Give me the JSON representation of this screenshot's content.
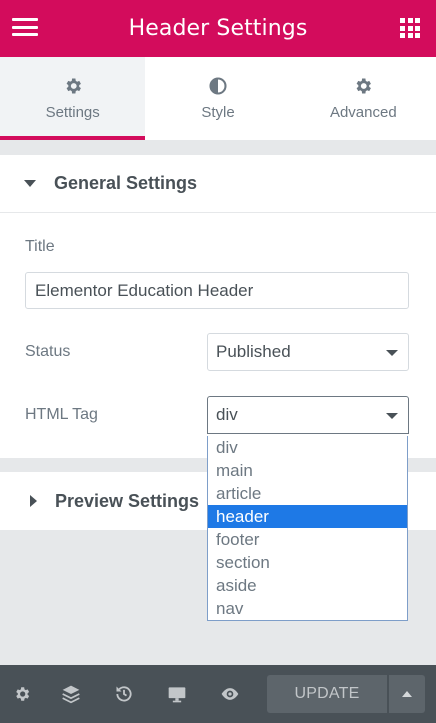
{
  "header": {
    "title": "Header Settings",
    "menu_icon": "hamburger-icon",
    "apps_icon": "grid-icon"
  },
  "tabs": [
    {
      "label": "Settings",
      "icon": "gear-icon",
      "active": true
    },
    {
      "label": "Style",
      "icon": "contrast-icon",
      "active": false
    },
    {
      "label": "Advanced",
      "icon": "gear-icon",
      "active": false
    }
  ],
  "general": {
    "title": "General Settings",
    "fields": {
      "title_label": "Title",
      "title_value": "Elementor Education Header",
      "status_label": "Status",
      "status_value": "Published",
      "html_tag_label": "HTML Tag",
      "html_tag_value": "div"
    }
  },
  "preview": {
    "title": "Preview Settings"
  },
  "html_tag_options": [
    "div",
    "main",
    "article",
    "header",
    "footer",
    "section",
    "aside",
    "nav"
  ],
  "html_tag_highlighted": "header",
  "footer": {
    "icons": [
      "settings-icon",
      "layers-icon",
      "history-icon",
      "responsive-icon",
      "preview-eye-icon"
    ],
    "update_label": "UPDATE"
  },
  "colors": {
    "brand": "#d30c5c",
    "highlight": "#1e79e6",
    "footer_bg": "#495157"
  }
}
